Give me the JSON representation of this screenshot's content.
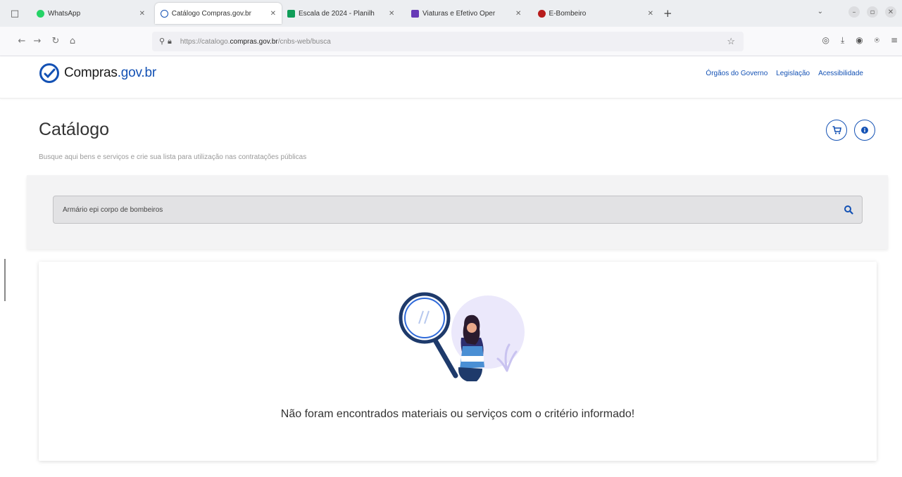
{
  "browser": {
    "tabs": [
      {
        "label": "WhatsApp",
        "favicon_color": "#25d366",
        "active": false
      },
      {
        "label": "Catálogo Compras.gov.br",
        "favicon_color": "#1351b4",
        "active": true
      },
      {
        "label": "Escala de 2024 - Planilh",
        "favicon_color": "#0f9d58",
        "active": false
      },
      {
        "label": "Viaturas e Efetivo Oper",
        "favicon_color": "#673ab7",
        "active": false
      },
      {
        "label": "E-Bombeiro",
        "favicon_color": "#b71c1c",
        "active": false
      }
    ],
    "url_prefix": "https://catalogo.",
    "url_domain": "compras.gov.br",
    "url_path": "/cnbs-web/busca"
  },
  "site": {
    "logo_text_main": "Compras",
    "logo_text_accent": ".gov.br",
    "links": [
      "Órgãos do Governo",
      "Legislação",
      "Acessibilidade"
    ]
  },
  "page": {
    "title": "Catálogo",
    "subtitle": "Busque aqui bens e serviços e crie sua lista para utilização nas contratações públicas",
    "search_value": "Armário epi corpo de bombeiros",
    "empty_message": "Não foram encontrados materiais ou serviços com o critério informado!"
  },
  "icons": {
    "cart": "cart-icon",
    "info": "info-icon",
    "search": "search-icon"
  },
  "colors": {
    "brand": "#1351b4"
  }
}
